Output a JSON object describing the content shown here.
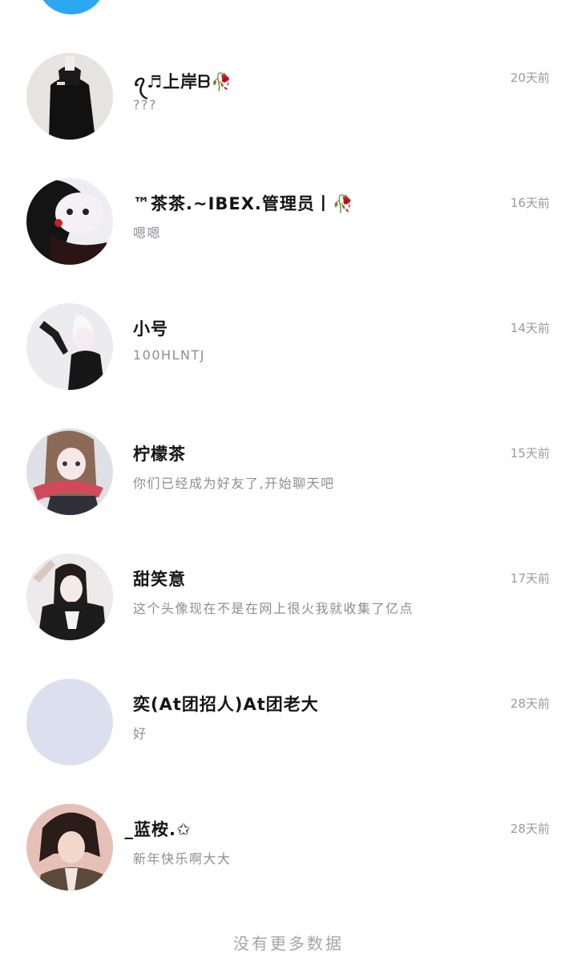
{
  "contacts": [
    {
      "name": "ꪖ♬上岸ᗷ🥀",
      "message": "???",
      "time": "20天前"
    },
    {
      "name": "™茶茶.~IBEX.管理员丨🥀",
      "message": "嗯嗯",
      "time": "16天前"
    },
    {
      "name": "小号",
      "message": "100HLNTJ",
      "time": "14天前"
    },
    {
      "name": "柠檬茶",
      "message": "你们已经成为好友了,开始聊天吧",
      "time": "15天前"
    },
    {
      "name": "甜笑意",
      "message": "这个头像现在不是在网上很火我就收集了亿点",
      "time": "17天前"
    },
    {
      "name": "奕(At团招人)At团老大",
      "message": "好",
      "time": "28天前"
    },
    {
      "name": "̲蓝桉.✩",
      "message": "新年快乐啊大大",
      "time": "28天前"
    }
  ],
  "footer_text": "没有更多数据",
  "colors": {
    "top_avatar": "#2aa8f2",
    "name": "#151515",
    "message": "#8d8d92",
    "time": "#9a9a9f",
    "placeholder_avatar": "#dcdfee"
  }
}
